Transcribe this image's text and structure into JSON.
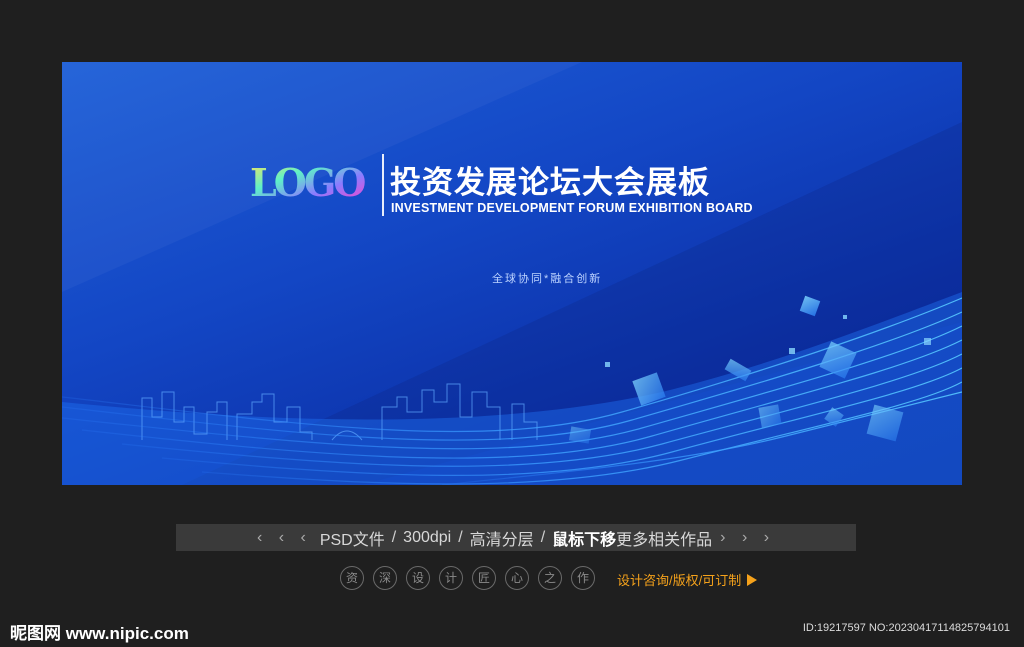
{
  "banner": {
    "logo_text": "LOGO",
    "title_cn": "投资发展论坛大会展板",
    "title_en": "INVESTMENT DEVELOPMENT FORUM EXHIBITION BOARD",
    "slogan": "全球协同*融合创新",
    "colors": {
      "background": "#1346c4",
      "accent": "#4fb8ff"
    }
  },
  "infobar": {
    "left_arrows": "‹ ‹ ‹",
    "file_type": "PSD文件",
    "resolution": "300dpi",
    "layers": "高清分层",
    "hover_bold": "鼠标下移",
    "hover_rest": "更多相关作品",
    "right_arrows": "› › ›"
  },
  "badges": [
    "资",
    "深",
    "设",
    "计",
    "匠",
    "心",
    "之",
    "作"
  ],
  "consult_link": "设计咨询/版权/可订制",
  "watermark": "昵图网 www.nipic.com",
  "image_id": "ID:19217597 NO:20230417114825794101"
}
